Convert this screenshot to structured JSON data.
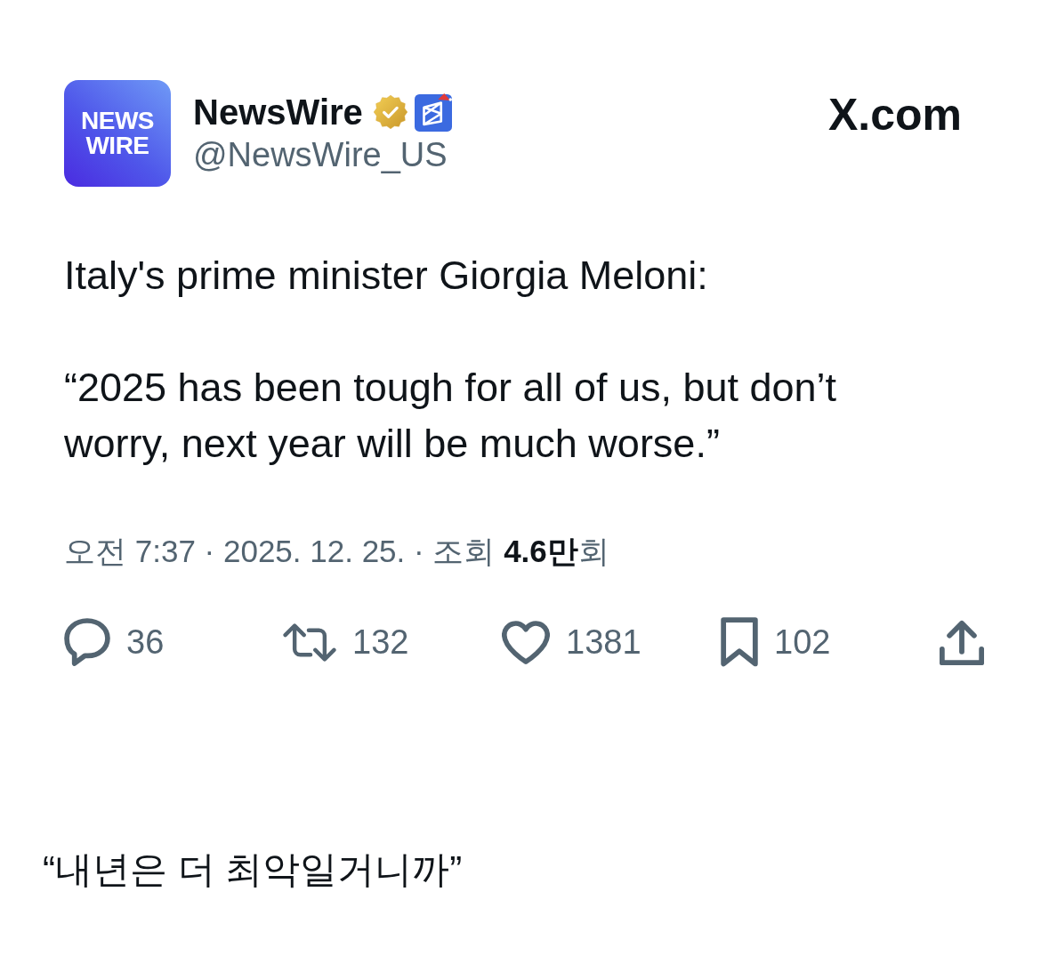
{
  "post": {
    "author": {
      "avatar_text": [
        "NEWS",
        "WIRE"
      ],
      "name": "NewsWire",
      "verified": true,
      "affiliate": true,
      "handle": "@NewsWire_US"
    },
    "source": "X.com",
    "paragraphs": [
      "Italy's prime minister Giorgia Meloni:",
      "“2025 has been tough for all of us, but don’t worry, next year will be much worse.”"
    ],
    "meta": "오전 7:37 · 2025. 12. 25. · 조회 **4.6만**회",
    "actions": [
      {
        "kind": "reply",
        "count": "36"
      },
      {
        "kind": "repost",
        "count": "132"
      },
      {
        "kind": "like",
        "count": "1381"
      },
      {
        "kind": "bookmark",
        "count": "102"
      },
      {
        "kind": "share"
      }
    ]
  },
  "caption": "“내년은 더 최악일거니까”"
}
